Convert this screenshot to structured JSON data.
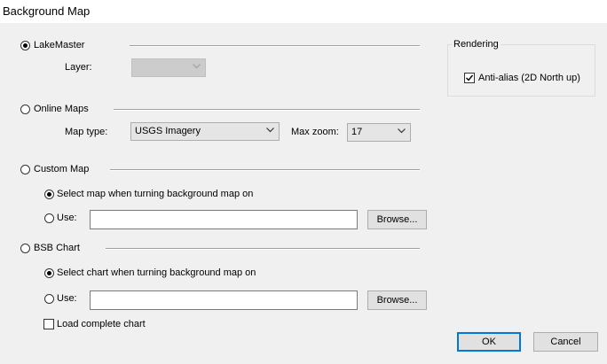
{
  "window": {
    "title": "Background Map"
  },
  "lakemaster": {
    "label": "LakeMaster",
    "layer_label": "Layer:",
    "layer_value": ""
  },
  "online_maps": {
    "label": "Online Maps",
    "map_type_label": "Map type:",
    "map_type_value": "USGS Imagery",
    "max_zoom_label": "Max zoom:",
    "max_zoom_value": "17"
  },
  "custom_map": {
    "label": "Custom Map",
    "select_option": "Select map when turning background map on",
    "use_label": "Use:",
    "use_value": "",
    "browse_label": "Browse..."
  },
  "bsb_chart": {
    "label": "BSB Chart",
    "select_option": "Select chart when turning background map on",
    "use_label": "Use:",
    "use_value": "",
    "browse_label": "Browse...",
    "load_complete_label": "Load complete chart"
  },
  "rendering": {
    "group_label": "Rendering",
    "anti_alias_label": "Anti-alias (2D North up)"
  },
  "buttons": {
    "ok": "OK",
    "cancel": "Cancel"
  }
}
